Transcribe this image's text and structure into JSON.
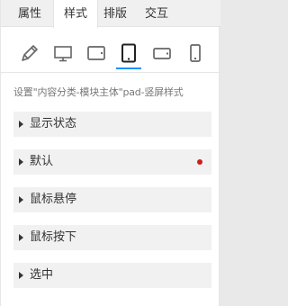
{
  "tabs": [
    {
      "label": "属性"
    },
    {
      "label": "样式",
      "active": true
    },
    {
      "label": "排版"
    },
    {
      "label": "交互"
    }
  ],
  "devices": [
    {
      "icon": "pencil-icon"
    },
    {
      "icon": "desktop-icon"
    },
    {
      "icon": "tablet-landscape-icon"
    },
    {
      "icon": "tablet-portrait-icon",
      "active": true
    },
    {
      "icon": "phone-landscape-icon"
    },
    {
      "icon": "phone-portrait-icon"
    }
  ],
  "description": "设置\"内容分类-模块主体\"pad-竖屏样式",
  "sections": [
    {
      "label": "显示状态"
    },
    {
      "label": "默认",
      "modified": true
    },
    {
      "label": "鼠标悬停"
    },
    {
      "label": "鼠标按下"
    },
    {
      "label": "选中"
    }
  ],
  "colors": {
    "accent": "#1e90ff",
    "modified_dot": "#cc1e1e"
  }
}
